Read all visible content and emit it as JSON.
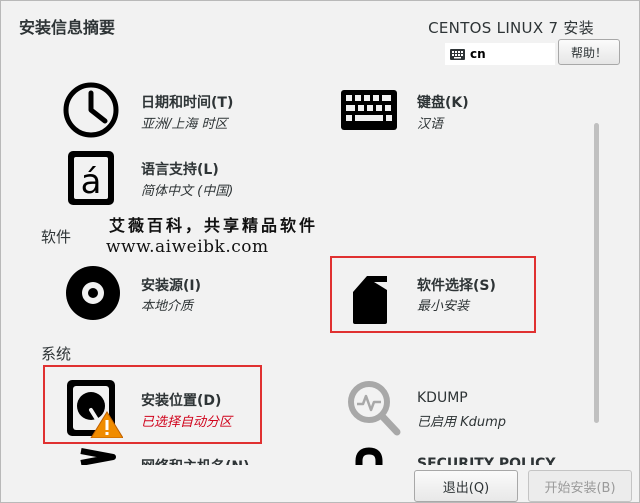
{
  "header": {
    "title": "安装信息摘要",
    "product": "CENTOS LINUX 7 安装",
    "keyboard_layout": "cn",
    "help_label": "帮助！"
  },
  "sections": {
    "software": "软件",
    "system": "系统"
  },
  "spokes": {
    "datetime": {
      "title": "日期和时间(T)",
      "status": "亚洲/上海 时区",
      "icon": "clock-icon"
    },
    "keyboard": {
      "title": "键盘(K)",
      "status": "汉语",
      "icon": "keyboard-icon"
    },
    "language": {
      "title": "语言支持(L)",
      "status": "简体中文 (中国)",
      "icon": "language-icon"
    },
    "source": {
      "title": "安装源(I)",
      "status": "本地介质",
      "icon": "disc-icon"
    },
    "software_selection": {
      "title": "软件选择(S)",
      "status": "最小安装",
      "icon": "package-icon"
    },
    "install_destination": {
      "title": "安装位置(D)",
      "status": "已选择自动分区",
      "icon": "harddisk-warning-icon",
      "status_color": "#d0021b"
    },
    "kdump": {
      "title": "KDUMP",
      "status": "已启用 Kdump",
      "icon": "kdump-search-icon"
    },
    "network": {
      "title": "网络和主机名(N)",
      "icon": "network-icon"
    },
    "security": {
      "title": "SECURITY POLICY",
      "icon": "lock-icon"
    }
  },
  "watermark": {
    "line1": "艾薇百科，共享精品软件",
    "line2": "www.aiweibk.com"
  },
  "footer": {
    "quit_label": "退出(Q)",
    "begin_label": "开始安装(B)"
  },
  "colors": {
    "highlight": "#e03131",
    "warning": "#d0021b"
  }
}
